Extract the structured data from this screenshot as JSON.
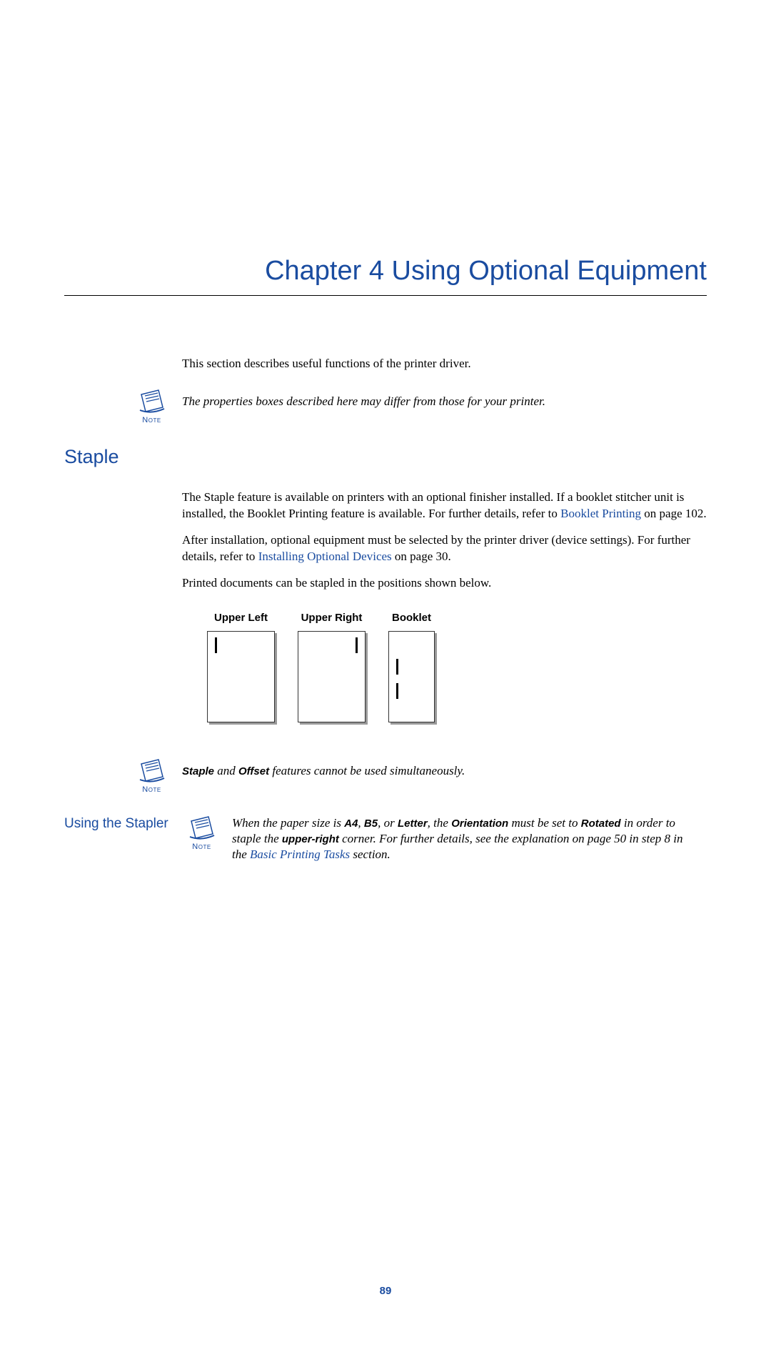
{
  "chapter": {
    "title": "Chapter 4  Using Optional Equipment"
  },
  "intro_text": "This section describes useful functions of the printer driver.",
  "note1": {
    "label": "Note",
    "text": "The properties boxes described here may differ from those for your printer."
  },
  "section1": {
    "heading": "Staple",
    "para1_pre": "The Staple feature is available on printers with an optional finisher installed. If a booklet stitcher unit is installed, the Booklet Printing feature is available. For further details, refer to ",
    "para1_link": "Booklet Printing",
    "para1_post": " on page 102.",
    "para2_pre": "After installation, optional equipment must be selected by the printer driver (device settings). For further details, refer to ",
    "para2_link": "Installing Optional Devices",
    "para2_post": " on page 30.",
    "para3": "Printed documents can be stapled in the positions shown below."
  },
  "diagrams": {
    "upper_left": "Upper Left",
    "upper_right": "Upper Right",
    "booklet": "Booklet"
  },
  "note2": {
    "label": "Note",
    "bold1": "Staple",
    "mid": " and ",
    "bold2": "Offset",
    "post": " features cannot be used simultaneously."
  },
  "subsection": {
    "heading": "Using the Stapler",
    "note": {
      "label": "Note",
      "t1": "When the paper size is ",
      "b1": "A4",
      "t2": ", ",
      "b2": "B5",
      "t3": ", or ",
      "b3": "Letter",
      "t4": ", the ",
      "b4": "Orientation",
      "t5": " must be set to ",
      "b5": "Rotated",
      "t6": " in order to staple the ",
      "b6": "upper-right",
      "t7": " corner. For further details, see the explanation on page 50 in step 8 in the ",
      "link": "Basic Printing Tasks",
      "t8": " section."
    }
  },
  "page_number": "89"
}
